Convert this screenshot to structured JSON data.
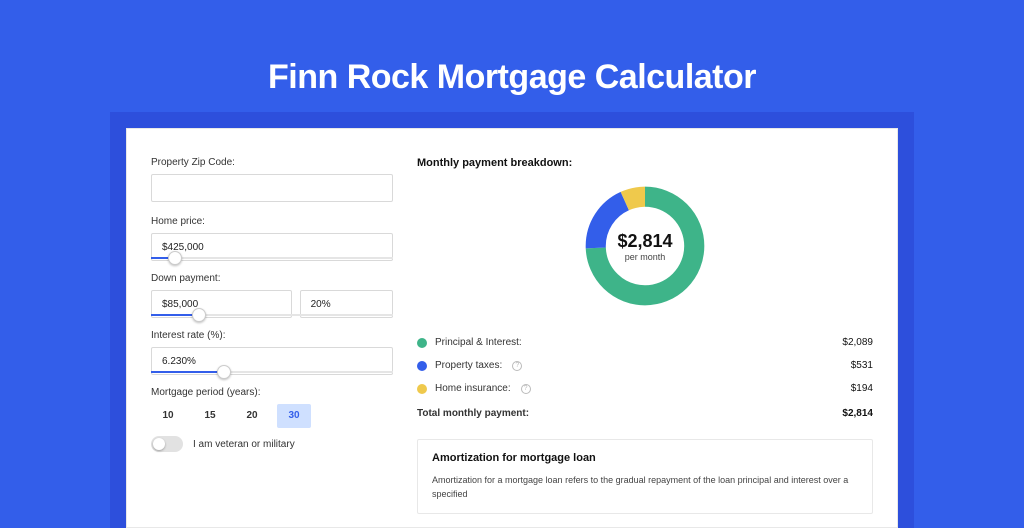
{
  "page": {
    "title": "Finn Rock Mortgage Calculator"
  },
  "form": {
    "zip": {
      "label": "Property Zip Code:",
      "value": ""
    },
    "home_price": {
      "label": "Home price:",
      "value": "$425,000",
      "slider_pct": 10
    },
    "down_payment": {
      "label": "Down payment:",
      "amount": "$85,000",
      "pct": "20%",
      "slider_pct": 20
    },
    "interest": {
      "label": "Interest rate (%):",
      "value": "6.230%",
      "slider_pct": 30
    },
    "period": {
      "label": "Mortgage period (years):",
      "options": [
        "10",
        "15",
        "20",
        "30"
      ],
      "active": "30"
    },
    "veteran": {
      "label": "I am veteran or military",
      "on": false
    }
  },
  "breakdown": {
    "title": "Monthly payment breakdown:",
    "total": "$2,814",
    "sub": "per month",
    "items": [
      {
        "key": "pi",
        "label": "Principal & Interest:",
        "value": "$2,089",
        "color": "#3eb489",
        "info": false
      },
      {
        "key": "tax",
        "label": "Property taxes:",
        "value": "$531",
        "color": "#335eea",
        "info": true
      },
      {
        "key": "ins",
        "label": "Home insurance:",
        "value": "$194",
        "color": "#efc94c",
        "info": true
      }
    ],
    "total_row": {
      "label": "Total monthly payment:",
      "value": "$2,814"
    }
  },
  "amortization": {
    "title": "Amortization for mortgage loan",
    "text": "Amortization for a mortgage loan refers to the gradual repayment of the loan principal and interest over a specified"
  },
  "chart_data": {
    "type": "pie",
    "title": "$2,814 per month",
    "series": [
      {
        "name": "Principal & Interest",
        "value": 2089,
        "color": "#3eb489"
      },
      {
        "name": "Property taxes",
        "value": 531,
        "color": "#335eea"
      },
      {
        "name": "Home insurance",
        "value": 194,
        "color": "#efc94c"
      }
    ],
    "total": 2814
  }
}
